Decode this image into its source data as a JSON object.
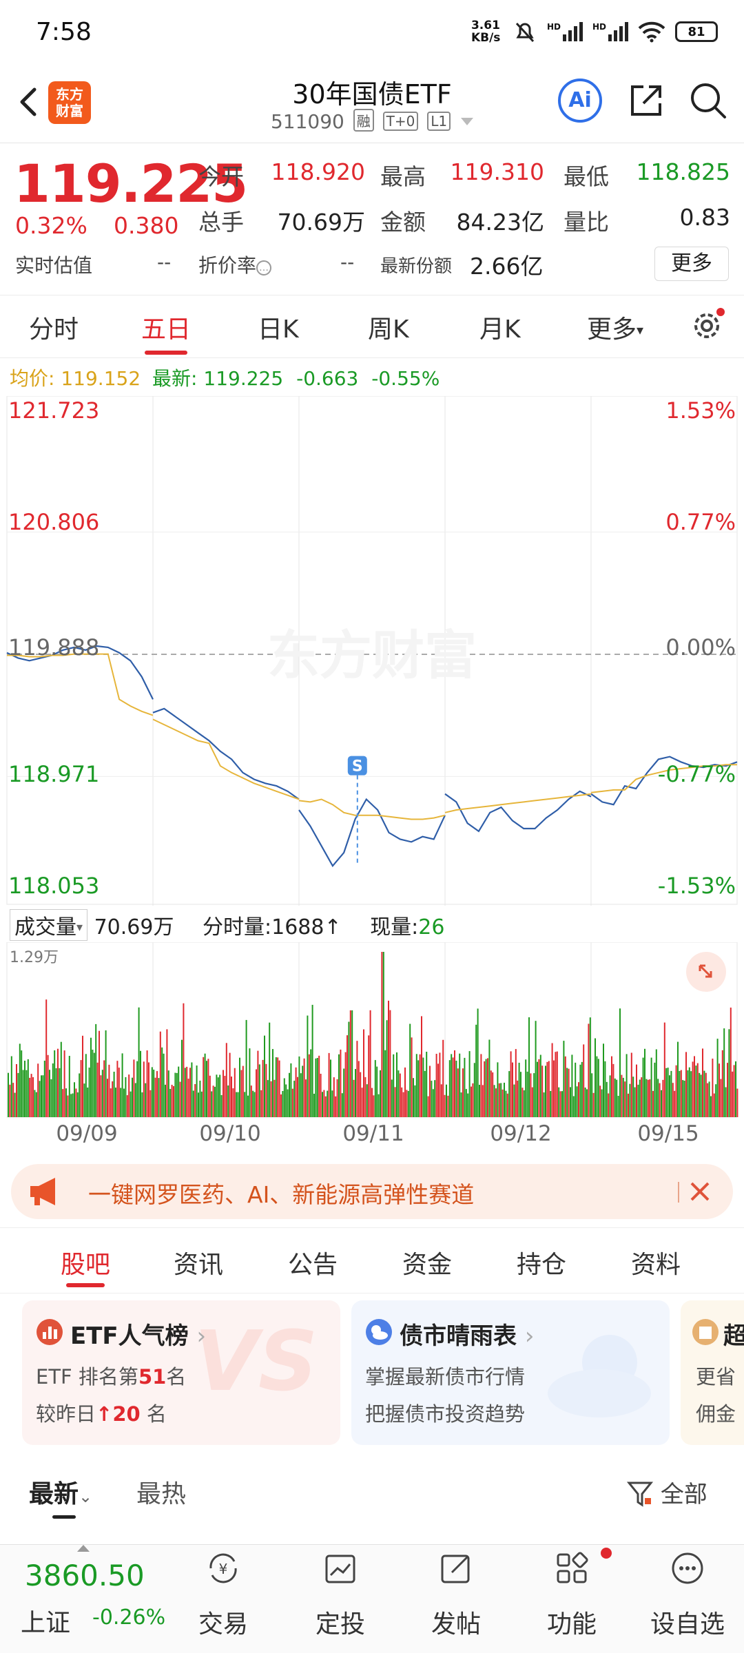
{
  "status_bar": {
    "time": "7:58",
    "net_speed": "3.61 KB/s",
    "signal_1": "HD",
    "signal_2": "HD",
    "battery": "81"
  },
  "header": {
    "logo_text": "东方财富",
    "title": "30年国债ETF",
    "code": "511090",
    "tags": [
      "融",
      "T+0",
      "L1"
    ]
  },
  "quote": {
    "price": "119.225",
    "change_pct": "0.32%",
    "change": "0.380",
    "open_label": "今开",
    "open": "118.920",
    "high_label": "最高",
    "high": "119.310",
    "low_label": "最低",
    "low": "118.825",
    "volume_label": "总手",
    "volume": "70.69万",
    "amount_label": "金额",
    "amount": "84.23亿",
    "ratio_label": "量比",
    "ratio": "0.83",
    "iopv_label": "实时估值",
    "iopv": "--",
    "discount_label": "折价率",
    "discount": "--",
    "shares_label": "最新份额",
    "shares": "2.66亿",
    "more_button": "更多"
  },
  "period_tabs": [
    "分时",
    "五日",
    "日K",
    "周K",
    "月K",
    "更多"
  ],
  "active_period": "五日",
  "chart_info": {
    "avg_label": "均价:",
    "avg": "119.152",
    "latest_label": "最新:",
    "latest": "119.225",
    "change": "-0.663",
    "change_pct": "-0.55%"
  },
  "chart_data": {
    "type": "line",
    "title": "",
    "xlabel": "",
    "ylabel": "",
    "ylim": [
      118.053,
      121.723
    ],
    "y_ticks_left": [
      "121.723",
      "120.806",
      "119.888",
      "118.971",
      "118.053"
    ],
    "y_ticks_right": [
      "1.53%",
      "0.77%",
      "0.00%",
      "-0.77%",
      "-1.53%"
    ],
    "x_categories": [
      "09/09",
      "09/10",
      "09/11",
      "09/12",
      "09/15"
    ],
    "watermark": "东方财富",
    "marker": {
      "label": "S",
      "day_index": 2,
      "position": 0.4
    },
    "series": [
      {
        "name": "",
        "color": "#2f5ea8",
        "values": [
          119.9,
          119.86,
          119.84,
          119.86,
          119.88,
          119.92,
          119.94,
          119.92,
          119.95,
          119.94,
          119.9,
          119.84,
          119.72,
          119.55,
          119.45,
          119.48,
          119.42,
          119.36,
          119.3,
          119.24,
          119.16,
          119.1,
          119.0,
          118.95,
          118.92,
          118.9,
          118.86,
          118.8,
          118.72,
          118.6,
          118.45,
          118.3,
          118.4,
          118.65,
          118.8,
          118.72,
          118.55,
          118.5,
          118.48,
          118.52,
          118.5,
          118.68,
          118.84,
          118.78,
          118.62,
          118.56,
          118.7,
          118.74,
          118.64,
          118.58,
          118.58,
          118.66,
          118.72,
          118.8,
          118.86,
          118.82,
          118.84,
          118.78,
          118.76,
          118.9,
          118.88,
          119.0,
          119.1,
          119.12,
          119.08,
          119.05,
          119.04,
          119.06,
          119.05,
          119.08
        ]
      },
      {
        "name": "",
        "color": "#e6b53a",
        "values": [
          119.88,
          119.88,
          119.87,
          119.87,
          119.88,
          119.88,
          119.89,
          119.89,
          119.89,
          119.89,
          119.55,
          119.5,
          119.46,
          119.43,
          119.4,
          119.36,
          119.32,
          119.28,
          119.24,
          119.22,
          119.05,
          119.0,
          118.96,
          118.92,
          118.89,
          118.86,
          118.83,
          118.8,
          118.79,
          118.78,
          118.8,
          118.76,
          118.7,
          118.68,
          118.68,
          118.68,
          118.67,
          118.66,
          118.65,
          118.65,
          118.66,
          118.68,
          118.7,
          118.72,
          118.73,
          118.74,
          118.75,
          118.76,
          118.77,
          118.78,
          118.79,
          118.8,
          118.81,
          118.82,
          118.83,
          118.84,
          118.85,
          118.86,
          118.87,
          118.87,
          118.95,
          118.98,
          119.0,
          119.02,
          119.03,
          119.04,
          119.05,
          119.05,
          119.06,
          119.06
        ]
      }
    ]
  },
  "volume_info": {
    "label": "成交量",
    "total": "70.69万",
    "tick_label": "分时量:1688",
    "now_label": "现量:",
    "now_value": "26",
    "max_label": "1.29万"
  },
  "banner": {
    "text": "一键网罗医药、AI、新能源高弹性赛道"
  },
  "info_tabs": [
    "股吧",
    "资讯",
    "公告",
    "资金",
    "持仓",
    "资料"
  ],
  "active_info_tab": "股吧",
  "cards": [
    {
      "title": "ETF人气榜",
      "line1_prefix": "ETF 排名第",
      "line1_value": "51",
      "line1_suffix": "名",
      "line2_prefix": "较昨日",
      "line2_value": "20",
      "line2_suffix": "名"
    },
    {
      "title": "债市晴雨表",
      "line1": "掌握最新债市行情",
      "line2": "把握债市投资趋势"
    },
    {
      "title": "超",
      "line1": "更省",
      "line2": "佣金"
    }
  ],
  "feed_sort": {
    "latest": "最新",
    "hottest": "最热",
    "filter": "全部"
  },
  "bottom_bar": {
    "index_value": "3860.50",
    "index_name": "上证",
    "index_change": "-0.26%",
    "items": [
      "交易",
      "定投",
      "发帖",
      "功能",
      "设自选"
    ]
  }
}
